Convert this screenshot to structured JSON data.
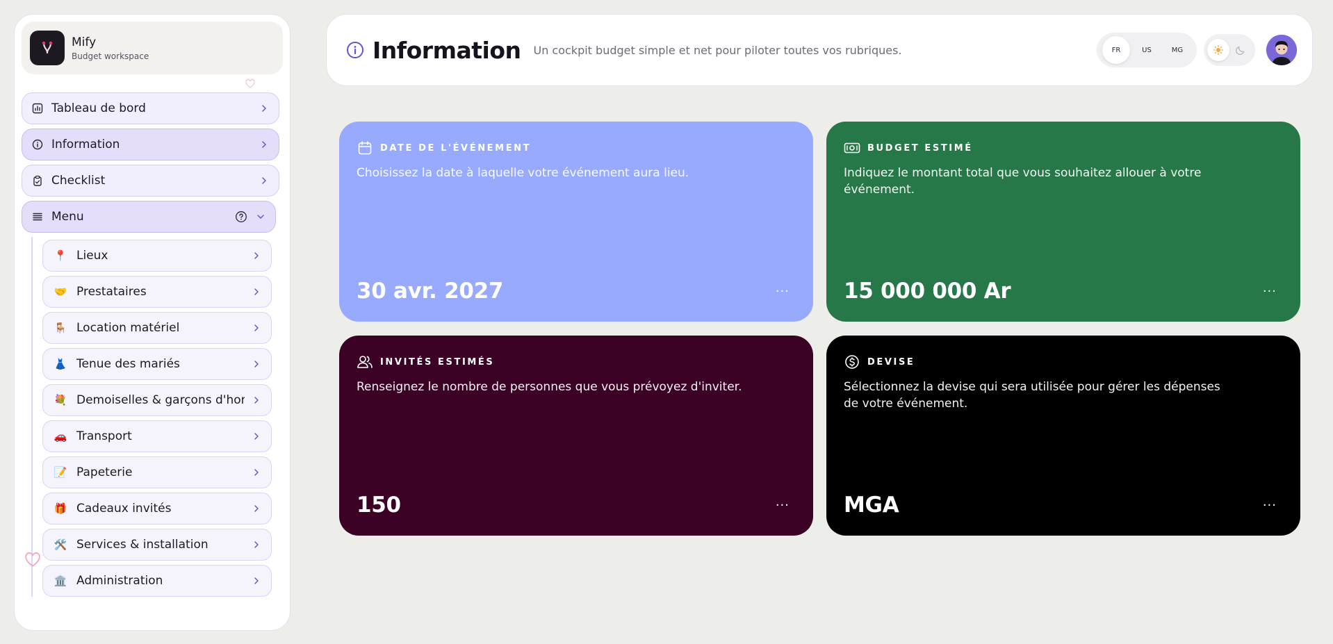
{
  "brand": {
    "name": "Mify",
    "subtitle": "Budget workspace"
  },
  "sidebar": {
    "items": [
      {
        "label": "Tableau de bord",
        "icon": "chart-icon"
      },
      {
        "label": "Information",
        "icon": "info-icon",
        "active": true
      },
      {
        "label": "Checklist",
        "icon": "clipboard-icon"
      },
      {
        "label": "Menu",
        "icon": "menu-stack-icon",
        "expanded": true
      }
    ],
    "submenu": [
      {
        "label": "Lieux",
        "emoji": "📍"
      },
      {
        "label": "Prestataires",
        "emoji": "🤝"
      },
      {
        "label": "Location matériel",
        "emoji": "🪑"
      },
      {
        "label": "Tenue des mariés",
        "emoji": "👗"
      },
      {
        "label": "Demoiselles & garçons d'honneur",
        "emoji": "💐"
      },
      {
        "label": "Transport",
        "emoji": "🚗"
      },
      {
        "label": "Papeterie",
        "emoji": "📝"
      },
      {
        "label": "Cadeaux invités",
        "emoji": "🎁"
      },
      {
        "label": "Services & installation",
        "emoji": "🛠️"
      },
      {
        "label": "Administration",
        "emoji": "🏛️"
      }
    ]
  },
  "header": {
    "title": "Information",
    "subtitle": "Un cockpit budget simple et net pour piloter toutes vos rubriques.",
    "languages": [
      "FR",
      "US",
      "MG"
    ],
    "active_language": "FR",
    "theme": "light"
  },
  "cards": {
    "date": {
      "title": "DATE DE L'ÉVÉNEMENT",
      "description": "Choisissez la date à laquelle votre événement aura lieu.",
      "value": "30 avr. 2027",
      "color": "#97aafd"
    },
    "budget": {
      "title": "BUDGET ESTIMÉ",
      "description": "Indiquez le montant total que vous souhaitez allouer à votre événement.",
      "value": "15 000 000 Ar",
      "color": "#277848"
    },
    "guests": {
      "title": "INVITÉS ESTIMÉS",
      "description": "Renseignez le nombre de personnes que vous prévoyez d'inviter.",
      "value": "150",
      "color": "#3b0226"
    },
    "currency": {
      "title": "DEVISE",
      "description": "Sélectionnez la devise qui sera utilisée pour gérer les dépenses de votre événement.",
      "value": "MGA",
      "color": "#000000"
    },
    "more_label": "···"
  },
  "colors": {
    "accent": "#6d4fd6",
    "nav_bg": "#f1eefd",
    "nav_border": "#d7cff2",
    "page_bg": "#ededea"
  }
}
